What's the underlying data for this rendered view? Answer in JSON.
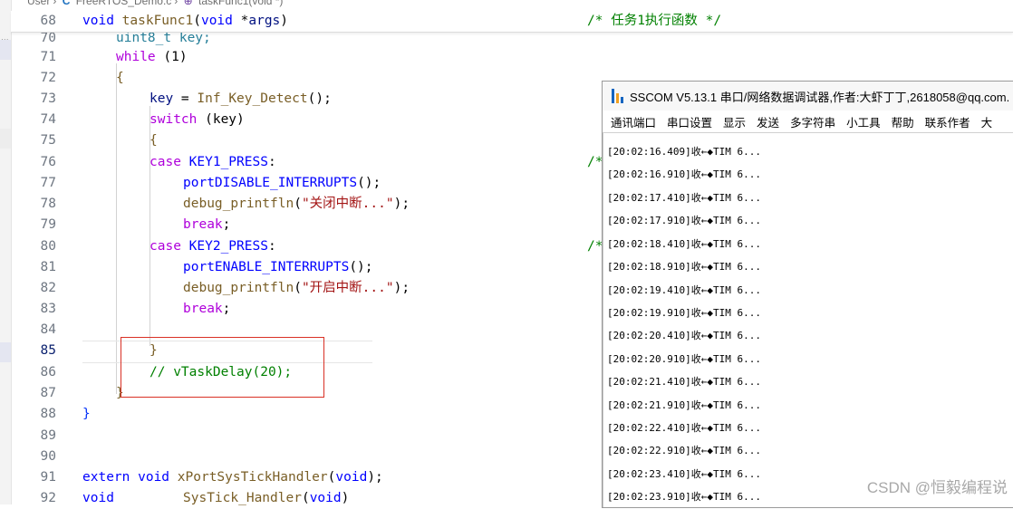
{
  "breadcrumb": {
    "folder": "User",
    "file_icon": "C",
    "file": "FreeRTOS_Demo.c",
    "function": "taskFunc1(void *)"
  },
  "editor": {
    "sticky": {
      "number": "68",
      "text": "void taskFunc1(void *args)",
      "comment": "/* 任务1执行函数 */"
    },
    "lines": {
      "l70": {
        "number": "70",
        "text": "uint8_t key;"
      },
      "l71": {
        "number": "71",
        "kw": "while",
        "rest": " (1)"
      },
      "l72": {
        "number": "72",
        "text": "{"
      },
      "l73": {
        "number": "73",
        "var": "key",
        "eq": " = ",
        "fn": "Inf_Key_Detect",
        "rest": "();"
      },
      "l74": {
        "number": "74",
        "kw": "switch",
        "rest": " (key)"
      },
      "l75": {
        "number": "75",
        "text": "{"
      },
      "l76": {
        "number": "76",
        "kw": "case",
        "mac": " KEY1_PRESS",
        "rest": ":",
        "cut": "/*"
      },
      "l77": {
        "number": "77",
        "fn": "portDISABLE_INTERRUPTS",
        "rest": "();"
      },
      "l78": {
        "number": "78",
        "fn": "debug_printfln",
        "open": "(",
        "str": "\"关闭中断...\"",
        "rest": ");"
      },
      "l79": {
        "number": "79",
        "kw": "break",
        "rest": ";"
      },
      "l80": {
        "number": "80",
        "kw": "case",
        "mac": " KEY2_PRESS",
        "rest": ":",
        "cut": "/*"
      },
      "l81": {
        "number": "81",
        "fn": "portENABLE_INTERRUPTS",
        "rest": "();"
      },
      "l82": {
        "number": "82",
        "fn": "debug_printfln",
        "open": "(",
        "str": "\"开启中断...\"",
        "rest": ");"
      },
      "l83": {
        "number": "83",
        "kw": "break",
        "rest": ";"
      },
      "l84": {
        "number": "84",
        "text": ""
      },
      "l85": {
        "number": "85",
        "text": "}"
      },
      "l86": {
        "number": "86",
        "text": "// vTaskDelay(20);"
      },
      "l87": {
        "number": "87",
        "text": "}"
      },
      "l88": {
        "number": "88",
        "text": "}"
      },
      "l89": {
        "number": "89",
        "text": ""
      },
      "l90": {
        "number": "90",
        "text": ""
      },
      "l91": {
        "number": "91",
        "kw": "extern",
        "kw2": " void",
        "fn": " xPortSysTickHandler",
        "open": "(",
        "kw3": "void",
        "rest": ");"
      },
      "l92": {
        "number": "92",
        "kw": "void",
        "fn": "SysTick_Handler",
        "open": "(",
        "kw3": "void",
        "rest": ")"
      }
    }
  },
  "sscom": {
    "title": "SSCOM V5.13.1 串口/网络数据调试器,作者:大虾丁丁,2618058@qq.com.",
    "menu": [
      "通讯端口",
      "串口设置",
      "显示",
      "发送",
      "多字符串",
      "小工具",
      "帮助",
      "联系作者",
      "大"
    ],
    "log": [
      "[20:02:16.409]收←◆TIM 6...",
      "[20:02:16.910]收←◆TIM 6...",
      "[20:02:17.410]收←◆TIM 6...",
      "[20:02:17.910]收←◆TIM 6...",
      "[20:02:18.410]收←◆TIM 6...",
      "[20:02:18.910]收←◆TIM 6...",
      "[20:02:19.410]收←◆TIM 6...",
      "[20:02:19.910]收←◆TIM 6...",
      "[20:02:20.410]收←◆TIM 6...",
      "[20:02:20.910]收←◆TIM 6...",
      "[20:02:21.410]收←◆TIM 6...",
      "[20:02:21.910]收←◆TIM 6...",
      "[20:02:22.410]收←◆TIM 6...",
      "[20:02:22.910]收←◆TIM 6...",
      "[20:02:23.410]收←◆TIM 6...",
      "[20:02:23.910]收←◆TIM 6..."
    ]
  },
  "watermark": "CSDN @恒毅编程说",
  "colors": {
    "keyword": "#0000ff",
    "control": "#af00db",
    "function": "#795e26",
    "string": "#a31515",
    "comment": "#008000",
    "number": "#098658",
    "highlight_box": "#d93025"
  }
}
